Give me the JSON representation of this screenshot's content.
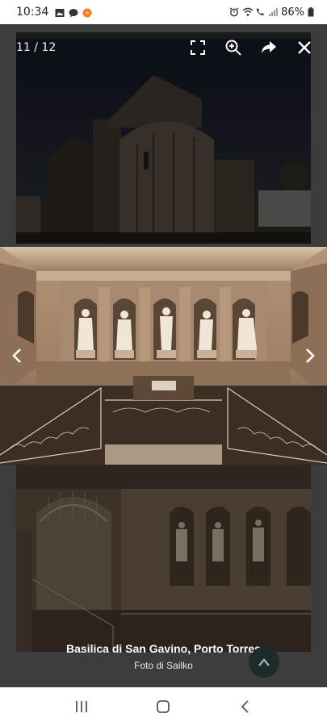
{
  "status_bar": {
    "time": "10:34",
    "battery": "86%",
    "left_icons": [
      "gallery-icon",
      "chat-icon",
      "notification-dot-icon"
    ],
    "right_icons": [
      "alarm-icon",
      "wifi-icon",
      "call-icon",
      "signal-icon",
      "battery-icon"
    ]
  },
  "viewer": {
    "counter": "11 / 12",
    "toolbar_icons": [
      "fullscreen-icon",
      "zoom-in-icon",
      "share-icon",
      "close-icon"
    ],
    "caption_title": "Basilica di San Gavino, Porto Torres",
    "caption_credit": "Foto di Sailko"
  },
  "colors": {
    "viewer_background": "#3c3c3c",
    "fab_background": "#1c2b2b",
    "text_on_dark": "#ffffff"
  },
  "nav_bar": {
    "buttons": [
      "recent-apps-icon",
      "home-icon",
      "back-icon"
    ]
  }
}
